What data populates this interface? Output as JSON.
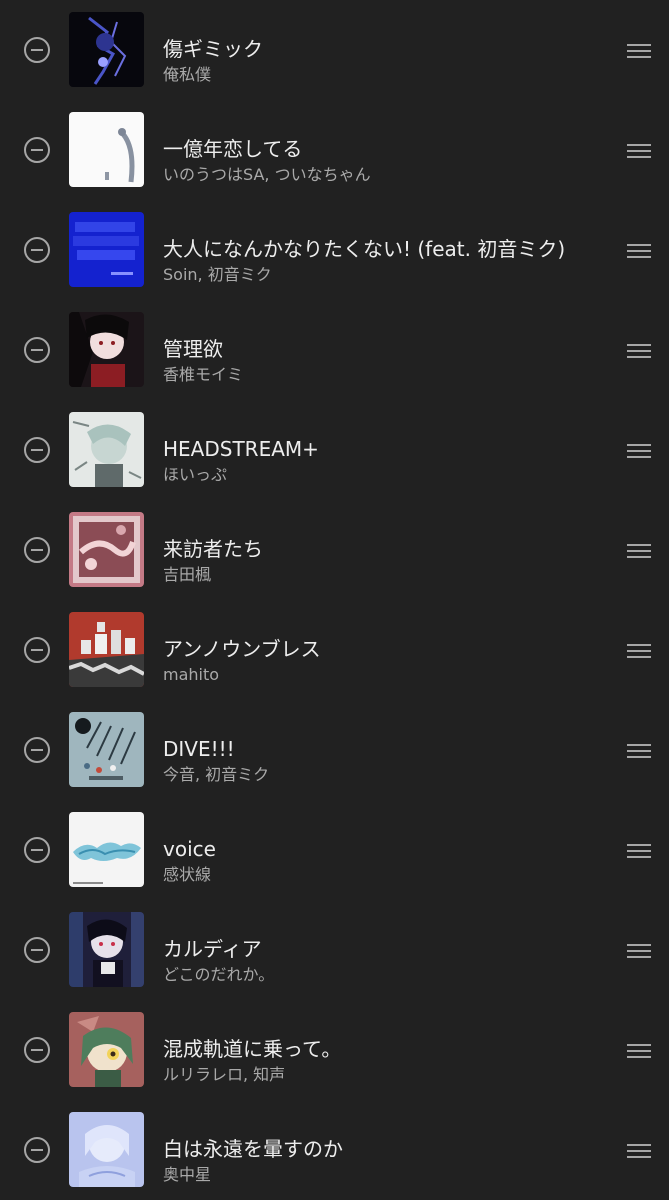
{
  "tracks": [
    {
      "title": "傷ギミック",
      "artist": "俺私僕"
    },
    {
      "title": "一億年恋してる",
      "artist": "いのうつはSA, ついなちゃん"
    },
    {
      "title": "大人になんかなりたくない! (feat. 初音ミク)",
      "artist": "Soin, 初音ミク"
    },
    {
      "title": "管理欲",
      "artist": "香椎モイミ"
    },
    {
      "title": "HEADSTREAM+",
      "artist": "ほいっぷ"
    },
    {
      "title": "来訪者たち",
      "artist": "吉田楓"
    },
    {
      "title": "アンノウンブレス",
      "artist": "mahito"
    },
    {
      "title": "DIVE!!!",
      "artist": "今音, 初音ミク"
    },
    {
      "title": "voice",
      "artist": "感状線"
    },
    {
      "title": "カルディア",
      "artist": "どこのだれか。"
    },
    {
      "title": "混成軌道に乗って。",
      "artist": "ルリラレロ, 知声"
    },
    {
      "title": "白は永遠を暈すのか",
      "artist": "奥中星"
    }
  ],
  "icons": {
    "remove": "minus-circle-icon",
    "reorder": "drag-handle-icon"
  },
  "colors": {
    "background": "#212121",
    "title": "#ededed",
    "artist": "#a9a9a9",
    "icon": "#a6a6a6"
  }
}
